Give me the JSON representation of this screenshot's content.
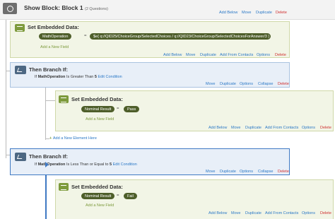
{
  "show_block": {
    "title": "Show Block: Block 1",
    "subtitle": "(2 Questions)",
    "actions": [
      "Add Below",
      "Move",
      "Duplicate",
      "Delete"
    ]
  },
  "embedded1": {
    "title": "Set Embedded Data:",
    "field": "MathOperation",
    "eq": "=",
    "value": "$e{ q://QID25/ChoiceGroup/SelectedChoices / q://QID23/ChoiceGroup/SelectedChoicesForAnswer/3 }",
    "add_field": "Add a New Field",
    "actions": [
      "Add Below",
      "Move",
      "Duplicate",
      "Add From Contacts",
      "Options",
      "Delete"
    ]
  },
  "branch1": {
    "title": "Then Branch If:",
    "cond_if": "If",
    "cond_field": "MathOperation",
    "cond_op": "Is Greater Than",
    "cond_value": "5",
    "edit": "Edit Condition",
    "actions": [
      "Move",
      "Duplicate",
      "Options",
      "Collapse",
      "Delete"
    ]
  },
  "embedded2": {
    "title": "Set Embedded Data:",
    "field": "Nominal Result",
    "eq": "=",
    "value": "Pass",
    "add_field": "Add a New Field",
    "actions": [
      "Add Below",
      "Move",
      "Duplicate",
      "Add From Contacts",
      "Options",
      "Delete"
    ]
  },
  "add_element": "Add a New Element Here",
  "branch2": {
    "title": "Then Branch If:",
    "cond_if": "If",
    "cond_field": "MathOperation",
    "cond_op": "Is Less Than or Equal to",
    "cond_value": "5",
    "edit": "Edit Condition",
    "actions": [
      "Move",
      "Duplicate",
      "Options",
      "Collapse",
      "Delete"
    ]
  },
  "embedded3": {
    "title": "Set Embedded Data:",
    "field": "Nominal Result",
    "eq": "=",
    "value": "Fail",
    "add_field": "Add a New Field",
    "actions": [
      "Add Below",
      "Move",
      "Duplicate",
      "Add From Contacts",
      "Options",
      "Delete"
    ]
  },
  "colors": {
    "link": "#2b78c6",
    "delete": "#d03030",
    "green_bg": "#f2f5e6",
    "blue_bg": "#e8eff8",
    "pill": "#4e5e2a",
    "selected_border": "#3f79c3"
  }
}
